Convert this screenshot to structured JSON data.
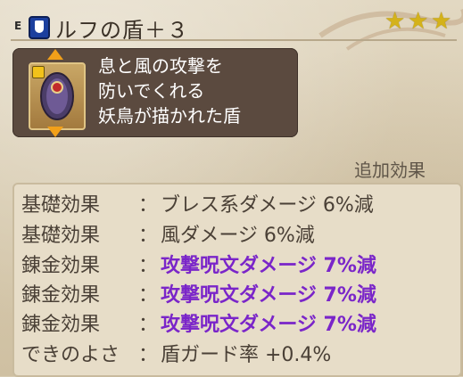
{
  "header": {
    "equip_mark": "E",
    "item_name": "ルフの盾＋３",
    "stars": 3
  },
  "description": {
    "line1": "息と風の攻撃を",
    "line2": "防いでくれる",
    "line3": "妖鳥が描かれた盾"
  },
  "extra_label": "追加効果",
  "effects": [
    {
      "category": "基礎効果",
      "separator": "：",
      "value": "ブレス系ダメージ 6%減",
      "color": "normal"
    },
    {
      "category": "基礎効果",
      "separator": "：",
      "value": "風ダメージ 6%減",
      "color": "normal"
    },
    {
      "category": "錬金効果",
      "separator": "：",
      "value": "攻撃呪文ダメージ 7%減",
      "color": "purple"
    },
    {
      "category": "錬金効果",
      "separator": "：",
      "value": "攻撃呪文ダメージ 7%減",
      "color": "purple"
    },
    {
      "category": "錬金効果",
      "separator": "：",
      "value": "攻撃呪文ダメージ 7%減",
      "color": "purple"
    },
    {
      "category": "できのよさ",
      "separator": "：",
      "value": "盾ガード率 +0.4%",
      "color": "normal"
    }
  ],
  "colors": {
    "purple_text": "#7a25c9",
    "star_gold": "#d4b21a",
    "desc_box": "#5b4a3f",
    "arrow_orange": "#f2a019"
  },
  "icons": [
    "shield-badge-icon",
    "star-icon",
    "lock-icon",
    "shield-icon",
    "arrow-up-icon",
    "arrow-down-icon"
  ]
}
